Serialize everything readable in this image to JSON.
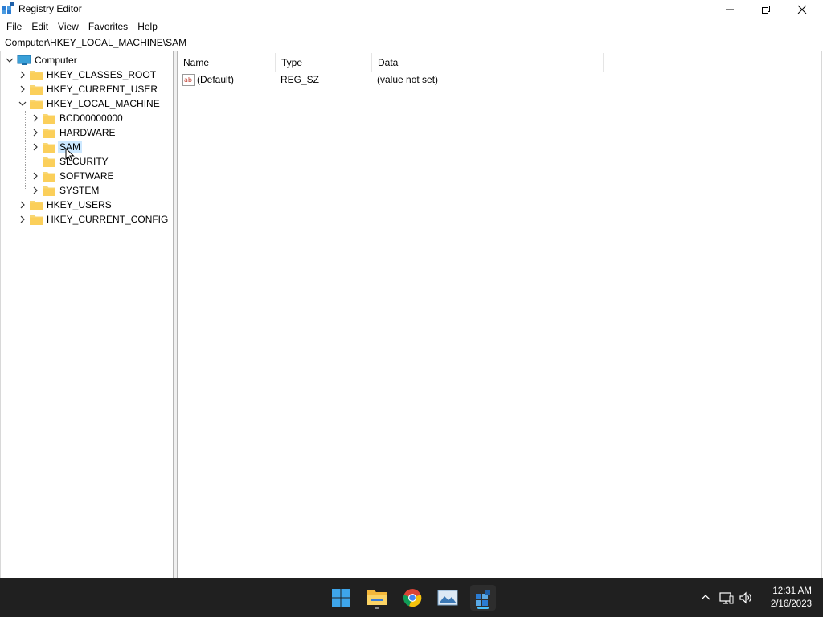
{
  "window": {
    "title": "Registry Editor",
    "icon": "registry-editor-icon"
  },
  "menu": {
    "items": [
      "File",
      "Edit",
      "View",
      "Favorites",
      "Help"
    ]
  },
  "address": {
    "path": "Computer\\HKEY_LOCAL_MACHINE\\SAM"
  },
  "tree": {
    "root": "Computer",
    "nodes": [
      "HKEY_CLASSES_ROOT",
      "HKEY_CURRENT_USER",
      "HKEY_LOCAL_MACHINE",
      "BCD00000000",
      "HARDWARE",
      "SAM",
      "SECURITY",
      "SOFTWARE",
      "SYSTEM",
      "HKEY_USERS",
      "HKEY_CURRENT_CONFIG"
    ],
    "selected": "SAM"
  },
  "values": {
    "columns": [
      "Name",
      "Type",
      "Data"
    ],
    "rows": [
      {
        "name": "(Default)",
        "type": "REG_SZ",
        "data": "(value not set)"
      }
    ]
  },
  "taskbar": {
    "apps": [
      "start-icon",
      "file-explorer-icon",
      "chrome-icon",
      "photos-icon",
      "registry-editor-icon"
    ],
    "clock": {
      "time": "12:31 AM",
      "date": "2/16/2023"
    }
  },
  "colors": {
    "selection": "#cce8ff",
    "folder": "#f8d775",
    "taskbar": "#202020",
    "accent": "#4cc2ff"
  }
}
